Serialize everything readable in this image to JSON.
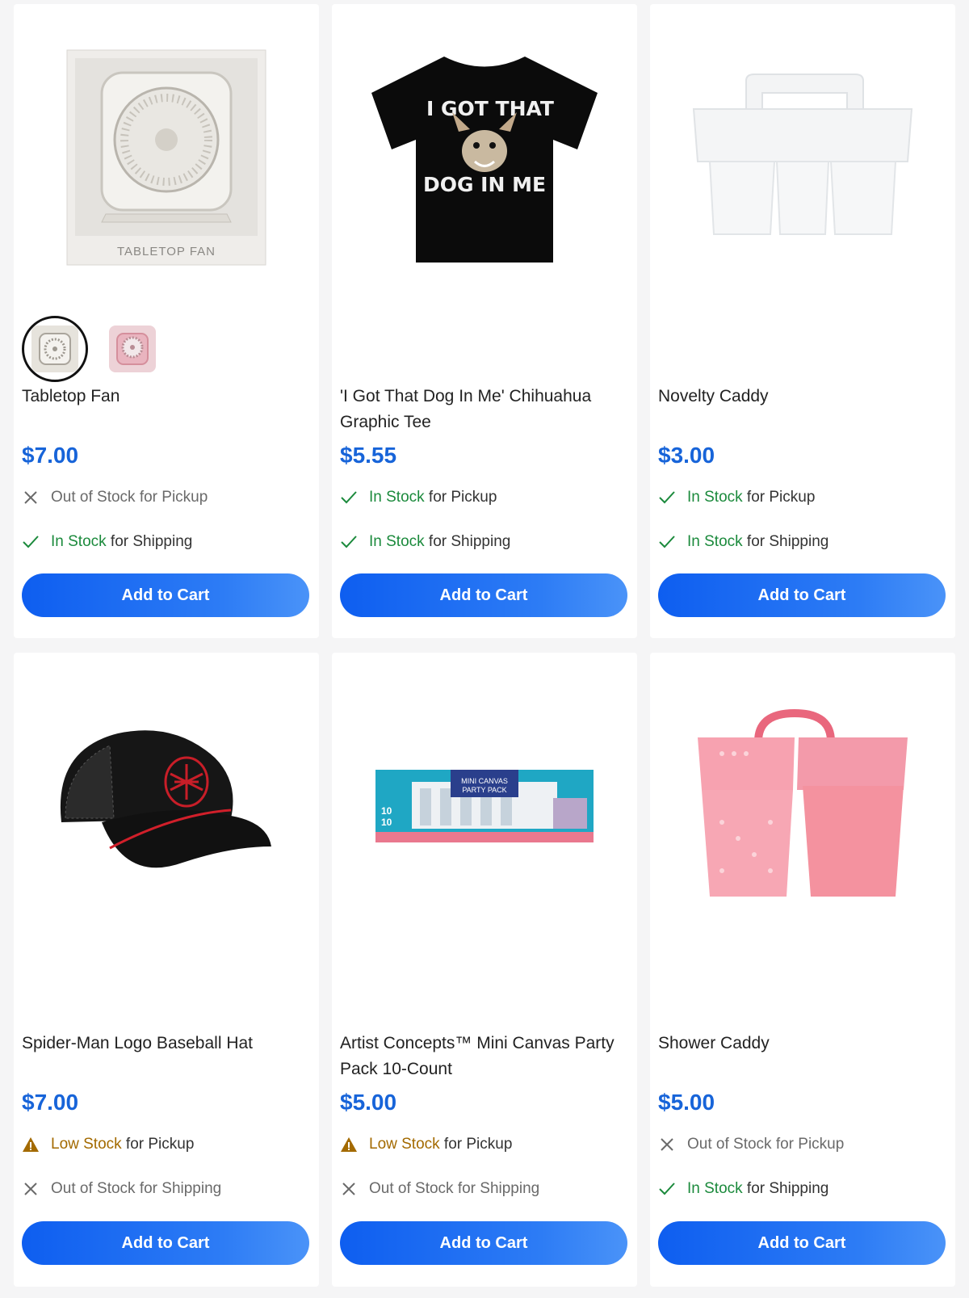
{
  "products": [
    {
      "title": "Tabletop Fan",
      "price": "$7.00",
      "pickup": {
        "status": "Out of Stock",
        "suffix": " for Pickup"
      },
      "shipping": {
        "status": "In Stock",
        "suffix": " for Shipping"
      },
      "button": "Add to Cart",
      "box_label": "TABLETOP FAN",
      "swatch_colors": [
        "#e6e3dc",
        "#e7b9c2"
      ]
    },
    {
      "title": "'I Got That Dog In Me' Chihuahua Graphic Tee",
      "price": "$5.55",
      "pickup": {
        "status": "In Stock",
        "suffix": " for Pickup"
      },
      "shipping": {
        "status": "In Stock",
        "suffix": " for Shipping"
      },
      "button": "Add to Cart",
      "shirt_text_top": "I GOT THAT",
      "shirt_text_bottom": "DOG IN ME"
    },
    {
      "title": "Novelty Caddy",
      "price": "$3.00",
      "pickup": {
        "status": "In Stock",
        "suffix": " for Pickup"
      },
      "shipping": {
        "status": "In Stock",
        "suffix": " for Shipping"
      },
      "button": "Add to Cart"
    },
    {
      "title": "Spider-Man Logo Baseball Hat",
      "price": "$7.00",
      "pickup": {
        "status": "Low Stock",
        "suffix": " for Pickup"
      },
      "shipping": {
        "status": "Out of Stock",
        "suffix": " for Shipping"
      },
      "button": "Add to Cart"
    },
    {
      "title": "Artist Concepts™ Mini Canvas Party Pack 10-Count",
      "price": "$5.00",
      "pickup": {
        "status": "Low Stock",
        "suffix": " for Pickup"
      },
      "shipping": {
        "status": "Out of Stock",
        "suffix": " for Shipping"
      },
      "button": "Add to Cart",
      "pack_label_1": "MINI CANVAS",
      "pack_label_2": "PARTY PACK",
      "pack_count_1": "10",
      "pack_count_2": "10"
    },
    {
      "title": "Shower Caddy",
      "price": "$5.00",
      "pickup": {
        "status": "Out of Stock",
        "suffix": " for Pickup"
      },
      "shipping": {
        "status": "In Stock",
        "suffix": " for Shipping"
      },
      "button": "Add to Cart"
    }
  ],
  "colors": {
    "accent": "#1764d9",
    "in_stock": "#1b8a3c",
    "low_stock": "#a36a00",
    "out_of_stock": "#6a6a6a",
    "button": "#0e5ef0"
  }
}
